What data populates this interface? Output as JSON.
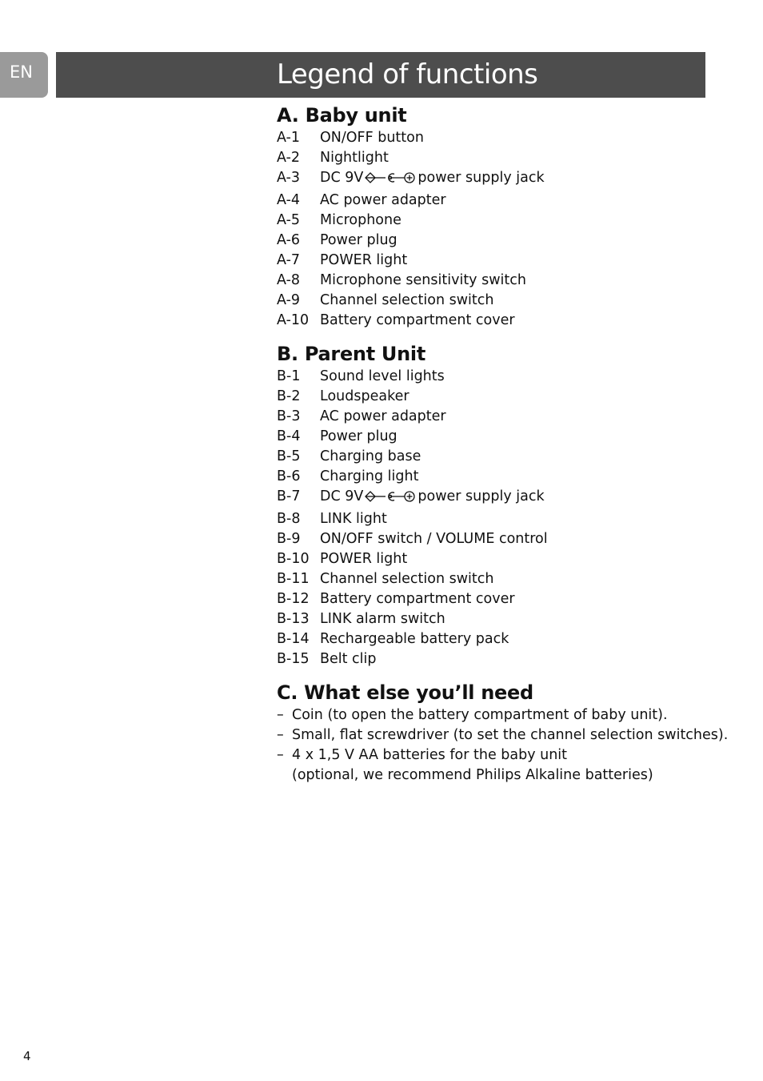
{
  "language_tab": "EN",
  "title": "Legend of functions",
  "sections": {
    "baby_unit": {
      "heading": "A. Baby unit",
      "items": [
        {
          "code": "A-1",
          "label": "ON/OFF button"
        },
        {
          "code": "A-2",
          "label": "Nightlight"
        },
        {
          "code": "A-3",
          "label_before": "DC 9V",
          "label_after": "power supply jack",
          "icon": "dc-polarity-symbol"
        },
        {
          "code": "A-4",
          "label": "AC power adapter"
        },
        {
          "code": "A-5",
          "label": "Microphone"
        },
        {
          "code": "A-6",
          "label": "Power plug"
        },
        {
          "code": "A-7",
          "label": "POWER light"
        },
        {
          "code": "A-8",
          "label": "Microphone sensitivity switch"
        },
        {
          "code": "A-9",
          "label": "Channel selection switch"
        },
        {
          "code": "A-10",
          "label": "Battery compartment cover"
        }
      ]
    },
    "parent_unit": {
      "heading": "B. Parent Unit",
      "items": [
        {
          "code": "B-1",
          "label": "Sound level lights"
        },
        {
          "code": "B-2",
          "label": "Loudspeaker"
        },
        {
          "code": "B-3",
          "label": "AC power adapter"
        },
        {
          "code": "B-4",
          "label": "Power plug"
        },
        {
          "code": "B-5",
          "label": "Charging base"
        },
        {
          "code": "B-6",
          "label": "Charging light"
        },
        {
          "code": "B-7",
          "label_before": "DC 9V",
          "label_after": "power supply jack",
          "icon": "dc-polarity-symbol"
        },
        {
          "code": "B-8",
          "label": "LINK light"
        },
        {
          "code": "B-9",
          "label": "ON/OFF switch / VOLUME control"
        },
        {
          "code": "B-10",
          "label": "POWER light"
        },
        {
          "code": "B-11",
          "label": "Channel selection switch"
        },
        {
          "code": "B-12",
          "label": "Battery compartment cover"
        },
        {
          "code": "B-13",
          "label": "LINK alarm switch"
        },
        {
          "code": "B-14",
          "label": "Rechargeable battery pack"
        },
        {
          "code": "B-15",
          "label": "Belt clip"
        }
      ]
    },
    "what_else": {
      "heading": "C. What else you’ll need",
      "items": [
        {
          "dash": "–",
          "lines": [
            "Coin (to open the battery compartment of baby unit)."
          ]
        },
        {
          "dash": "–",
          "lines": [
            "Small, flat screwdriver (to set the channel selection switches)."
          ]
        },
        {
          "dash": "–",
          "lines": [
            "4 x 1,5 V AA batteries for the baby unit",
            "(optional, we recommend Philips Alkaline batteries)"
          ]
        }
      ]
    }
  },
  "page_number": "4"
}
